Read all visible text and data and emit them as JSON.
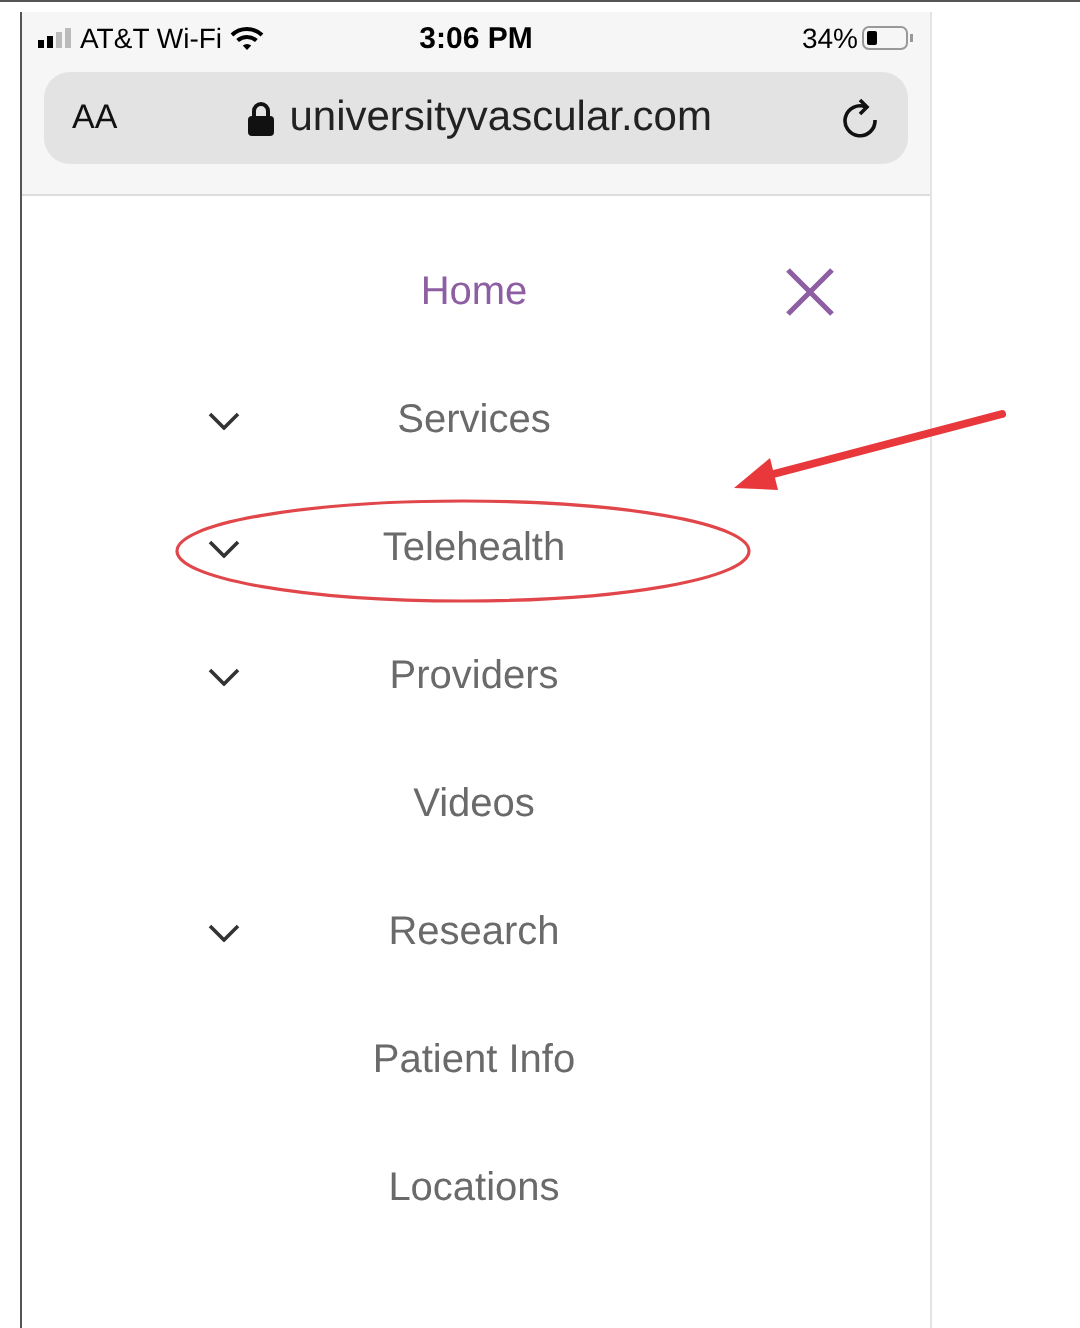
{
  "status_bar": {
    "carrier": "AT&T Wi-Fi",
    "time": "3:06 PM",
    "battery": "34%"
  },
  "address_bar": {
    "text_size_button": "AA",
    "url": "universityvascular.com"
  },
  "menu": {
    "items": [
      {
        "label": "Home",
        "kind": "link",
        "selected": true,
        "circled": false
      },
      {
        "label": "Services",
        "kind": "dropdown",
        "selected": false,
        "circled": false
      },
      {
        "label": "Telehealth",
        "kind": "dropdown",
        "selected": false,
        "circled": true
      },
      {
        "label": "Providers",
        "kind": "dropdown",
        "selected": false,
        "circled": false
      },
      {
        "label": "Videos",
        "kind": "link",
        "selected": false,
        "circled": false
      },
      {
        "label": "Research",
        "kind": "dropdown",
        "selected": false,
        "circled": false
      },
      {
        "label": "Patient Info",
        "kind": "link",
        "selected": false,
        "circled": false
      },
      {
        "label": "Locations",
        "kind": "link",
        "selected": false,
        "circled": false
      }
    ]
  }
}
